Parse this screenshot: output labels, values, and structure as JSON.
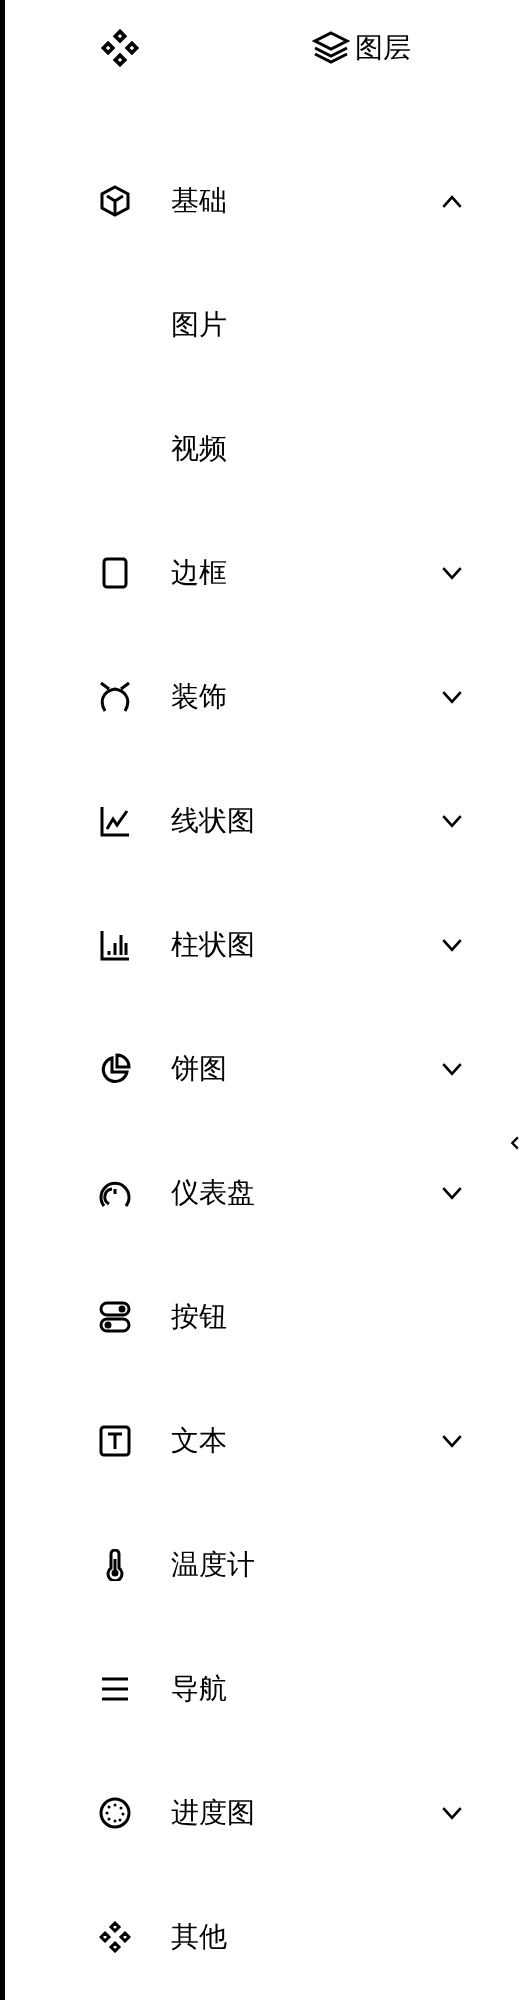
{
  "header": {
    "title": "图层"
  },
  "menu": [
    {
      "label": "基础",
      "expanded": true,
      "children": [
        {
          "label": "图片"
        },
        {
          "label": "视频"
        }
      ]
    },
    {
      "label": "边框",
      "expanded": false
    },
    {
      "label": "装饰",
      "expanded": false
    },
    {
      "label": "线状图",
      "expanded": false
    },
    {
      "label": "柱状图",
      "expanded": false
    },
    {
      "label": "饼图",
      "expanded": false
    },
    {
      "label": "仪表盘",
      "expanded": false
    },
    {
      "label": "按钮"
    },
    {
      "label": "文本",
      "expanded": false
    },
    {
      "label": "温度计"
    },
    {
      "label": "导航"
    },
    {
      "label": "进度图",
      "expanded": false
    },
    {
      "label": "其他"
    }
  ]
}
